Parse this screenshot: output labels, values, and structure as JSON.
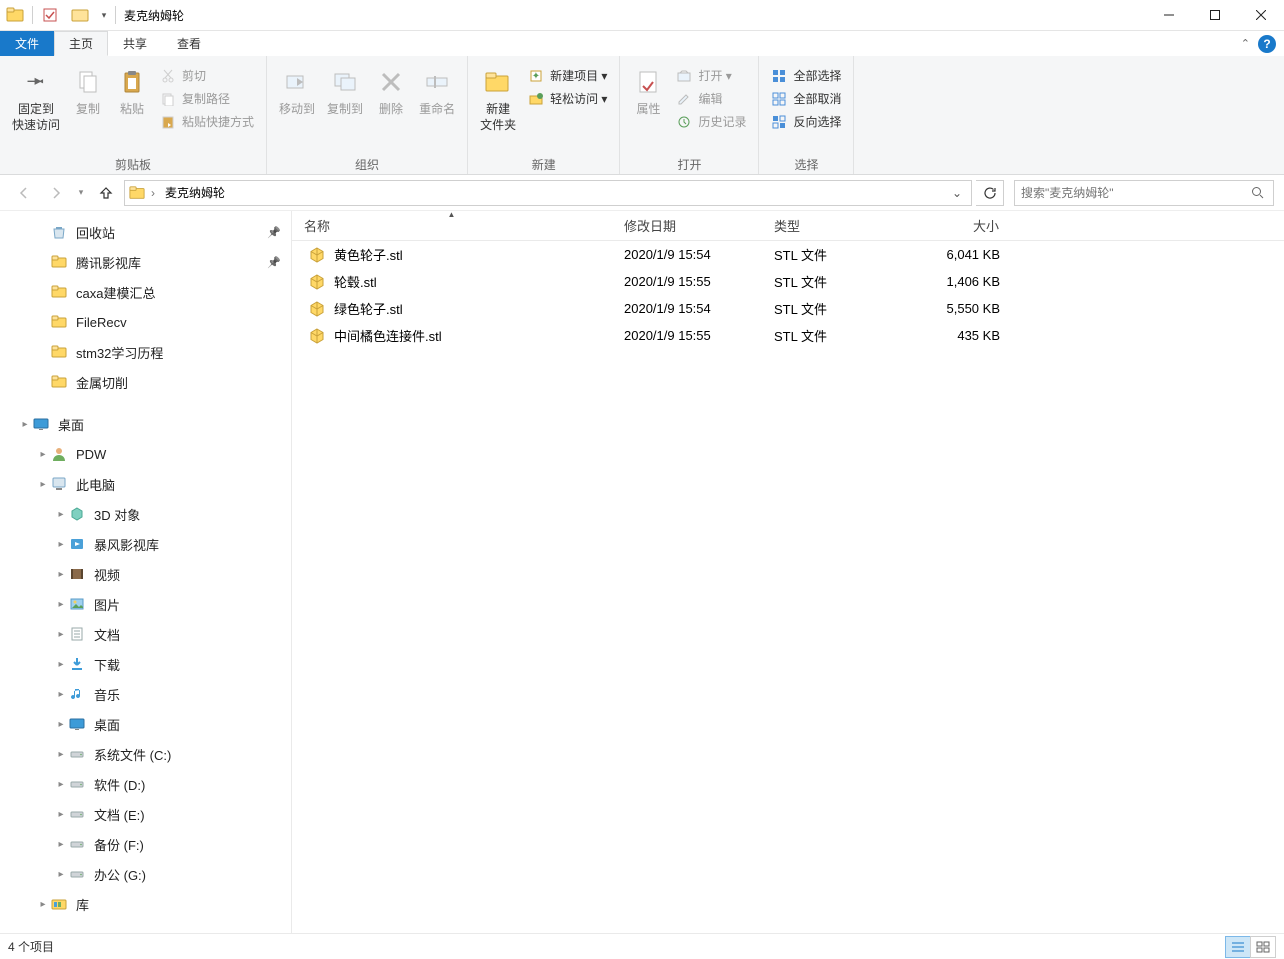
{
  "window": {
    "title": "麦克纳姆轮",
    "controls": {
      "min": "minimize",
      "max": "maximize",
      "close": "close"
    }
  },
  "tabs": {
    "file": "文件",
    "items": [
      "主页",
      "共享",
      "查看"
    ],
    "active_index": 0
  },
  "ribbon": {
    "groups": [
      {
        "label": "剪贴板",
        "big": [
          {
            "icon": "pin",
            "label": "固定到\n快速访问",
            "disabled": false
          },
          {
            "icon": "copy",
            "label": "复制",
            "disabled": true
          },
          {
            "icon": "paste",
            "label": "粘贴",
            "disabled": true
          }
        ],
        "small": [
          {
            "icon": "cut",
            "label": "剪切",
            "disabled": true
          },
          {
            "icon": "copypath",
            "label": "复制路径",
            "disabled": true
          },
          {
            "icon": "pasteshortcut",
            "label": "粘贴快捷方式",
            "disabled": true
          }
        ]
      },
      {
        "label": "组织",
        "big": [
          {
            "icon": "moveto",
            "label": "移动到",
            "disabled": true
          },
          {
            "icon": "copyto",
            "label": "复制到",
            "disabled": true
          },
          {
            "icon": "delete",
            "label": "删除",
            "disabled": true
          },
          {
            "icon": "rename",
            "label": "重命名",
            "disabled": true
          }
        ],
        "small": []
      },
      {
        "label": "新建",
        "big": [
          {
            "icon": "newfolder",
            "label": "新建\n文件夹",
            "disabled": false
          }
        ],
        "small": [
          {
            "icon": "newitem",
            "label": "新建项目 ▾",
            "disabled": false
          },
          {
            "icon": "easyaccess",
            "label": "轻松访问 ▾",
            "disabled": false
          }
        ]
      },
      {
        "label": "打开",
        "big": [
          {
            "icon": "properties",
            "label": "属性",
            "disabled": true
          }
        ],
        "small": [
          {
            "icon": "open",
            "label": "打开 ▾",
            "disabled": true
          },
          {
            "icon": "edit",
            "label": "编辑",
            "disabled": true
          },
          {
            "icon": "history",
            "label": "历史记录",
            "disabled": true
          }
        ]
      },
      {
        "label": "选择",
        "big": [],
        "small": [
          {
            "icon": "selectall",
            "label": "全部选择",
            "disabled": false
          },
          {
            "icon": "selectnone",
            "label": "全部取消",
            "disabled": false
          },
          {
            "icon": "invert",
            "label": "反向选择",
            "disabled": false
          }
        ]
      }
    ]
  },
  "nav": {
    "breadcrumb": [
      "麦克纳姆轮"
    ],
    "search_placeholder": "搜索\"麦克纳姆轮\""
  },
  "tree": {
    "sections": [
      {
        "items": [
          {
            "indent": 1,
            "icon": "recycle",
            "label": "回收站",
            "pinned": true
          },
          {
            "indent": 1,
            "icon": "folder",
            "label": "腾讯影视库",
            "pinned": true
          },
          {
            "indent": 1,
            "icon": "folder",
            "label": "caxa建模汇总",
            "pinned": false
          },
          {
            "indent": 1,
            "icon": "folder",
            "label": "FileRecv",
            "pinned": false
          },
          {
            "indent": 1,
            "icon": "folder",
            "label": "stm32学习历程",
            "pinned": false
          },
          {
            "indent": 1,
            "icon": "folder",
            "label": "金属切削",
            "pinned": false
          }
        ]
      },
      {
        "items": [
          {
            "indent": 0,
            "icon": "desktop",
            "label": "桌面",
            "expandable": true
          },
          {
            "indent": 1,
            "icon": "user",
            "label": "PDW",
            "expandable": true
          },
          {
            "indent": 1,
            "icon": "thispc",
            "label": "此电脑",
            "expandable": true
          },
          {
            "indent": 2,
            "icon": "3d",
            "label": "3D 对象",
            "expandable": true
          },
          {
            "indent": 2,
            "icon": "media",
            "label": "暴风影视库",
            "expandable": true
          },
          {
            "indent": 2,
            "icon": "video",
            "label": "视频",
            "expandable": true
          },
          {
            "indent": 2,
            "icon": "pictures",
            "label": "图片",
            "expandable": true
          },
          {
            "indent": 2,
            "icon": "documents",
            "label": "文档",
            "expandable": true
          },
          {
            "indent": 2,
            "icon": "downloads",
            "label": "下载",
            "expandable": true
          },
          {
            "indent": 2,
            "icon": "music",
            "label": "音乐",
            "expandable": true
          },
          {
            "indent": 2,
            "icon": "desktop",
            "label": "桌面",
            "expandable": true
          },
          {
            "indent": 2,
            "icon": "drive",
            "label": "系统文件 (C:)",
            "expandable": true
          },
          {
            "indent": 2,
            "icon": "drive",
            "label": "软件 (D:)",
            "expandable": true
          },
          {
            "indent": 2,
            "icon": "drive",
            "label": "文档 (E:)",
            "expandable": true
          },
          {
            "indent": 2,
            "icon": "drive",
            "label": "备份 (F:)",
            "expandable": true
          },
          {
            "indent": 2,
            "icon": "drive",
            "label": "办公 (G:)",
            "expandable": true
          },
          {
            "indent": 1,
            "icon": "library",
            "label": "库",
            "expandable": true
          }
        ]
      }
    ]
  },
  "files": {
    "columns": {
      "name": "名称",
      "date": "修改日期",
      "type": "类型",
      "size": "大小"
    },
    "sort_column": "name",
    "rows": [
      {
        "name": "黄色轮子.stl",
        "date": "2020/1/9 15:54",
        "type": "STL 文件",
        "size": "6,041 KB"
      },
      {
        "name": "轮毂.stl",
        "date": "2020/1/9 15:55",
        "type": "STL 文件",
        "size": "1,406 KB"
      },
      {
        "name": "绿色轮子.stl",
        "date": "2020/1/9 15:54",
        "type": "STL 文件",
        "size": "5,550 KB"
      },
      {
        "name": "中间橘色连接件.stl",
        "date": "2020/1/9 15:55",
        "type": "STL 文件",
        "size": "435 KB"
      }
    ]
  },
  "status": {
    "text": "4 个项目"
  }
}
